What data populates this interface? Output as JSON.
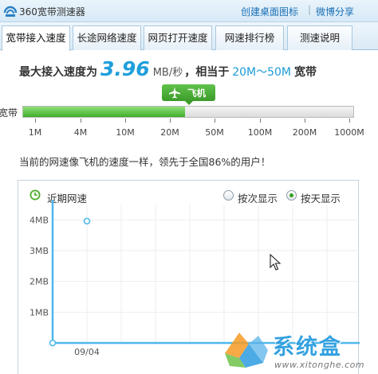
{
  "app": {
    "title": "360宽带测速器",
    "links": {
      "desktop_icon": "创建桌面图标",
      "separator": "|",
      "weibo_share": "微博分享"
    }
  },
  "tabs": [
    {
      "label": "宽带接入速度",
      "active": true
    },
    {
      "label": "长途网络速度",
      "active": false
    },
    {
      "label": "网页打开速度",
      "active": false
    },
    {
      "label": "网速排行榜",
      "active": false
    },
    {
      "label": "测速说明",
      "active": false
    }
  ],
  "summary": {
    "prefix": "最大接入速度为",
    "speed": "3.96",
    "unit": "MB/秒",
    "middle": "，相当于",
    "range": "20M～50M",
    "suffix": "宽带"
  },
  "speed_bar": {
    "label": "宽带",
    "marker_label": "飞机",
    "fill_fraction": 0.49,
    "scale": [
      "1M",
      "4M",
      "10M",
      "20M",
      "50M",
      "100M",
      "200M",
      "1000M"
    ]
  },
  "status_text": "当前的网速像飞机的速度一样，领先于全国86%的用户！",
  "recent_panel": {
    "title": "近期网速",
    "options": [
      {
        "label": "按次显示",
        "checked": false
      },
      {
        "label": "按天显示",
        "checked": true
      }
    ]
  },
  "chart_data": {
    "type": "line",
    "x": [
      "09/04"
    ],
    "yticks": [
      "1MB",
      "2MB",
      "3MB",
      "4MB"
    ],
    "ylim": [
      0,
      4.5
    ],
    "series": [
      {
        "values": [
          3.96
        ]
      }
    ],
    "grid": true
  },
  "watermark": {
    "name": "系统盒",
    "url": "www.xitonghe.com"
  },
  "colors": {
    "accent": "#1f9fdb",
    "bar_fill": "#45b532",
    "chart_axis": "#4fb8ec",
    "grid": "#eeeeee"
  }
}
